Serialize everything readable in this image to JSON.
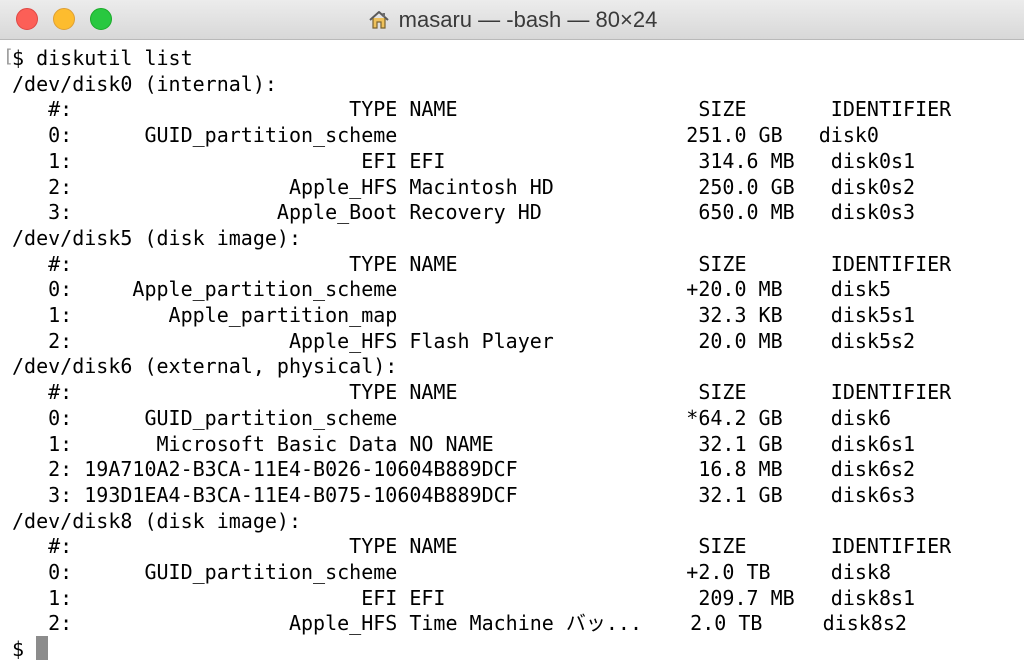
{
  "window": {
    "title": "masaru — -bash — 80×24"
  },
  "terminal": {
    "lines": [
      "$ diskutil list",
      "/dev/disk0 (internal):",
      "   #:                       TYPE NAME                    SIZE       IDENTIFIER",
      "   0:      GUID_partition_scheme                        251.0 GB   disk0",
      "   1:                        EFI EFI                     314.6 MB   disk0s1",
      "   2:                  Apple_HFS Macintosh HD            250.0 GB   disk0s2",
      "   3:                 Apple_Boot Recovery HD             650.0 MB   disk0s3",
      "/dev/disk5 (disk image):",
      "   #:                       TYPE NAME                    SIZE       IDENTIFIER",
      "   0:     Apple_partition_scheme                        +20.0 MB    disk5",
      "   1:        Apple_partition_map                         32.3 KB    disk5s1",
      "   2:                  Apple_HFS Flash Player            20.0 MB    disk5s2",
      "/dev/disk6 (external, physical):",
      "   #:                       TYPE NAME                    SIZE       IDENTIFIER",
      "   0:      GUID_partition_scheme                        *64.2 GB    disk6",
      "   1:       Microsoft Basic Data NO NAME                 32.1 GB    disk6s1",
      "   2: 19A710A2-B3CA-11E4-B026-10604B889DCF               16.8 MB    disk6s2",
      "   3: 193D1EA4-B3CA-11E4-B075-10604B889DCF               32.1 GB    disk6s3",
      "/dev/disk8 (disk image):",
      "   #:                       TYPE NAME                    SIZE       IDENTIFIER",
      "   0:      GUID_partition_scheme                        +2.0 TB     disk8",
      "   1:                        EFI EFI                     209.7 MB   disk8s1",
      "   2:                  Apple_HFS Time Machine バッ...    2.0 TB     disk8s2",
      "$ "
    ]
  },
  "colors": {
    "close": "#fc5f57",
    "minimize": "#fdbc2e",
    "maximize": "#28c840",
    "cursor": "#8c8c8c"
  },
  "icons": {
    "title_icon": "home-icon"
  }
}
